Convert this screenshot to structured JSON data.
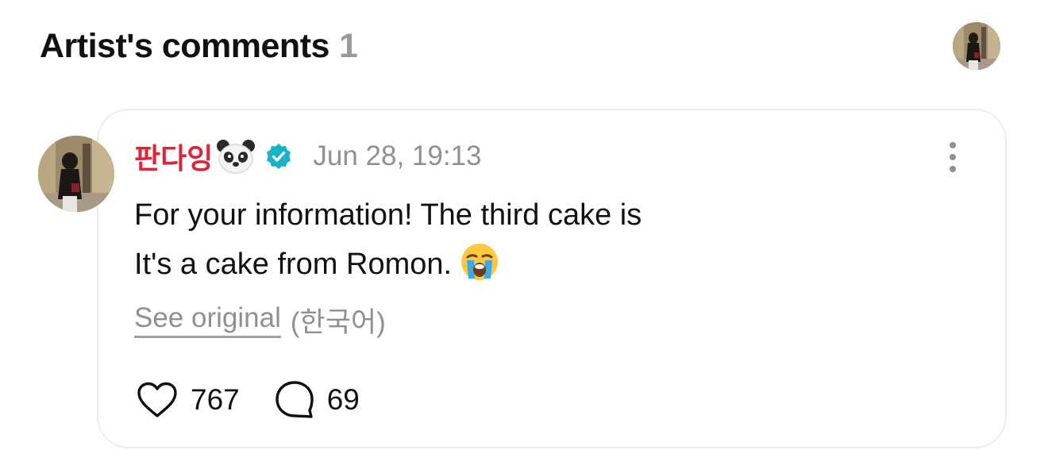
{
  "header": {
    "title": "Artist's comments",
    "count": "1"
  },
  "comment": {
    "author": "판다잉",
    "author_icons": [
      "panda-icon",
      "verified-badge-icon"
    ],
    "timestamp": "Jun 28, 19:13",
    "lines": [
      "For your information! The third cake is",
      "It's a cake from Romon."
    ],
    "emoji": "loudly-crying-face",
    "see_original": "See original",
    "original_language": "(한국어)",
    "likes": "767",
    "replies": "69"
  },
  "colors": {
    "author": "#e02437",
    "verified": "#19b3c7",
    "muted": "#8f8f94",
    "card_border": "#ececef"
  }
}
